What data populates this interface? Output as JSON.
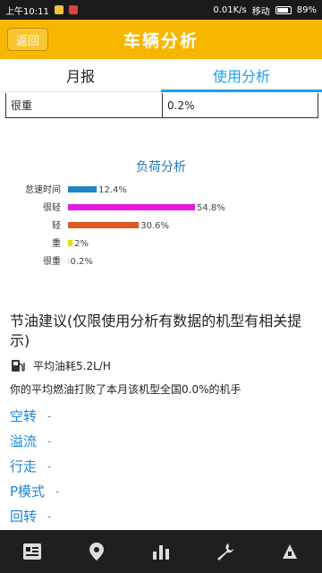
{
  "status_bar": {
    "time": "上午10:11",
    "speed": "0.01K/s",
    "carrier": "移动",
    "battery": "89%"
  },
  "header": {
    "back_label": "返回",
    "title": "车辆分析"
  },
  "tabs": [
    {
      "label": "月报",
      "active": false
    },
    {
      "label": "使用分析",
      "active": true
    }
  ],
  "table_row": {
    "label": "很重",
    "value": "0.2%"
  },
  "chart_data": {
    "type": "bar",
    "title": "负荷分析",
    "categories": [
      "怠速时间",
      "很轻",
      "轻",
      "重",
      "很重"
    ],
    "values": [
      12.4,
      54.8,
      30.6,
      2,
      0.2
    ],
    "value_labels": [
      "12.4%",
      "54.8%",
      "30.6%",
      "2%",
      "0.2%"
    ],
    "colors": [
      "#1f86c4",
      "#e61adf",
      "#e05a20",
      "#e8e000",
      "#b0b0b0"
    ],
    "xlim": [
      0,
      60
    ]
  },
  "advice": {
    "title": "节油建议(仅限使用分析有数据的机型有相关提示)",
    "avg_fuel": "平均油耗5.2L/H",
    "rank_text": "你的平均燃油打败了本月该机型全国0.0%的机手",
    "modes": [
      {
        "label": "空转",
        "value": "-"
      },
      {
        "label": "溢流",
        "value": "-"
      },
      {
        "label": "行走",
        "value": "-"
      },
      {
        "label": "P模式",
        "value": "-"
      },
      {
        "label": "回转",
        "value": "-"
      }
    ]
  },
  "bottom_nav": [
    {
      "icon": "list-icon"
    },
    {
      "icon": "location-pin-icon"
    },
    {
      "icon": "bar-chart-icon"
    },
    {
      "icon": "wrench-icon"
    },
    {
      "icon": "more-icon"
    }
  ]
}
